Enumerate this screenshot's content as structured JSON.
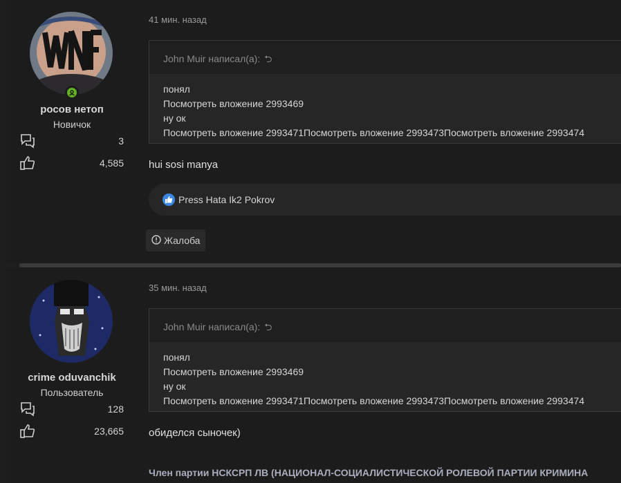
{
  "posts": [
    {
      "time": "41 мин. назад",
      "username": "росов нетоп",
      "user_title": "Новичок",
      "messages_count": "3",
      "reactions_count": "4,585",
      "online": true,
      "quote": {
        "author": "John Muir написал(а):",
        "lines": [
          "понял",
          "Посмотреть вложение 2993469",
          "ну ок",
          "Посмотреть вложение 2993471Посмотреть вложение 2993473Посмотреть вложение 2993474"
        ]
      },
      "message": "hui sosi manya",
      "reaction_summary": "Press Hata Ik2 Pokrov",
      "report_label": "Жалоба"
    },
    {
      "time": "35 мин. назад",
      "username": "crime oduvanchik",
      "user_title": "Пользователь",
      "messages_count": "128",
      "reactions_count": "23,665",
      "quote": {
        "author": "John Muir написал(а):",
        "lines": [
          "понял",
          "Посмотреть вложение 2993469",
          "ну ок",
          "Посмотреть вложение 2993471Посмотреть вложение 2993473Посмотреть вложение 2993474"
        ]
      },
      "message": "обиделся сыночек)",
      "signature": "Член партии НСКСРП ЛВ (НАЦИОНАЛ-СОЦИАЛИСТИЧЕСКОЙ РОЛЕВОЙ ПАРТИИ КРИМИНА"
    }
  ],
  "colors": {
    "online": "#63b324",
    "like": "#3b86e0",
    "background": "#1c1c1c"
  }
}
